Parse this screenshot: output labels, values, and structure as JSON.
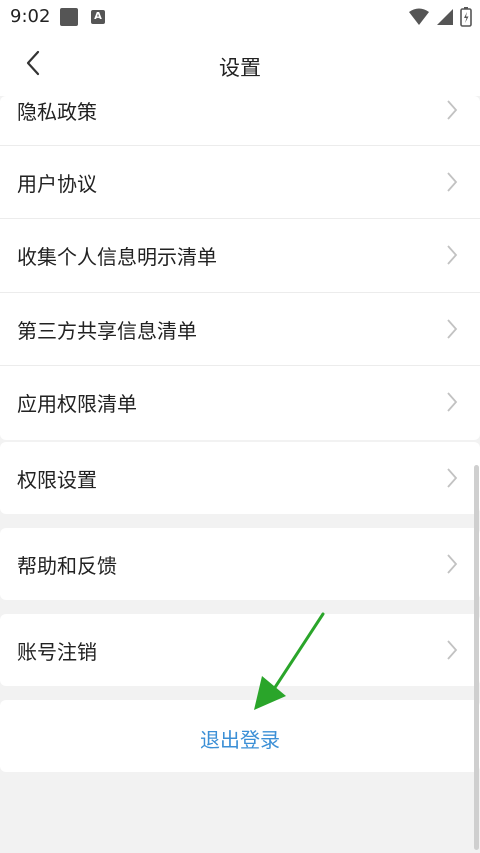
{
  "status": {
    "time": "9:02",
    "a_icon": "A"
  },
  "header": {
    "title": "设置"
  },
  "menu": [
    "隐私政策",
    "用户协议",
    "收集个人信息明示清单",
    "第三方共享信息清单",
    "应用权限清单",
    "权限设置",
    "帮助和反馈",
    "账号注销"
  ],
  "logout": {
    "label": "退出登录"
  },
  "colors": {
    "accent": "#3b8fd6",
    "arrow": "#2aa52a",
    "background": "#f2f2f2"
  }
}
